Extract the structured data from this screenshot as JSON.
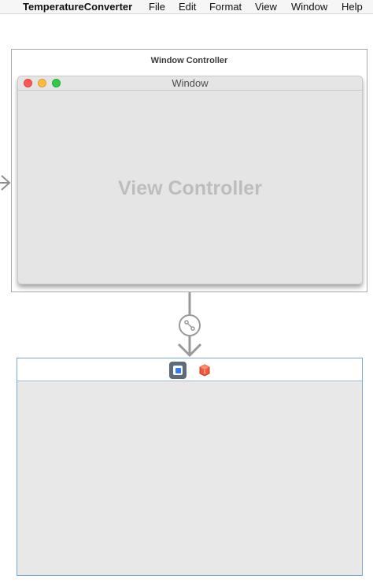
{
  "menubar": {
    "app_name": "TemperatureConverter",
    "items": [
      "File",
      "Edit",
      "Format",
      "View",
      "Window",
      "Help"
    ]
  },
  "window_controller_scene": {
    "title": "Window Controller",
    "window_title": "Window",
    "content_placeholder": "View Controller"
  },
  "view_controller_scene": {
    "dock_icons": [
      "view-controller-icon",
      "first-responder-icon"
    ]
  },
  "colors": {
    "selection_border": "#7aa7e0",
    "traffic_close": "#fc5753",
    "traffic_minimize": "#fdbc40",
    "traffic_zoom": "#34c84a"
  }
}
